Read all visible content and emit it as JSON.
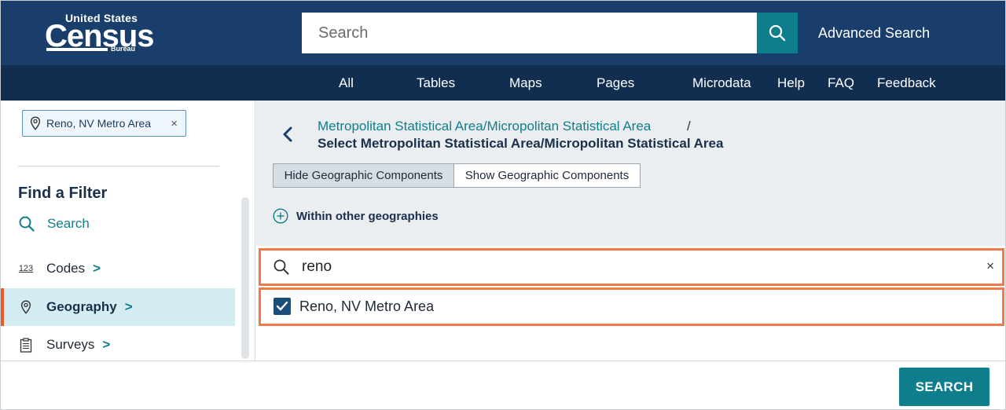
{
  "header": {
    "logo": {
      "line1": "United States",
      "line2": "Census",
      "line3": "Bureau"
    },
    "search": {
      "placeholder": "Search",
      "value": ""
    },
    "advanced_search": "Advanced Search"
  },
  "nav": {
    "items": [
      {
        "label": "All"
      },
      {
        "label": "Tables"
      },
      {
        "label": "Maps"
      },
      {
        "label": "Pages"
      },
      {
        "label": "Microdata"
      },
      {
        "label": "Help"
      },
      {
        "label": "FAQ"
      },
      {
        "label": "Feedback"
      }
    ]
  },
  "sidebar": {
    "chip": {
      "label": "Reno, NV Metro Area",
      "remove": "×",
      "icon": "location-pin-icon"
    },
    "find_filter_title": "Find a Filter",
    "search_label": "Search",
    "items": [
      {
        "label": "Codes",
        "icon": "codes-123-icon",
        "chevron": ">",
        "active": false
      },
      {
        "label": "Geography",
        "icon": "location-pin-icon",
        "chevron": ">",
        "active": true
      },
      {
        "label": "Surveys",
        "icon": "clipboard-icon",
        "chevron": ">",
        "active": false
      }
    ],
    "codes_icon_text": "123"
  },
  "main": {
    "breadcrumb": {
      "link": "Metropolitan Statistical Area/Micropolitan Statistical Area",
      "separator": "/",
      "current": "Select Metropolitan Statistical Area/Micropolitan Statistical Area"
    },
    "toggle": {
      "hide": "Hide Geographic Components",
      "show": "Show Geographic Components",
      "selected": "hide"
    },
    "within_label": "Within other geographies",
    "filter": {
      "value": "reno",
      "clear": "×"
    },
    "results": [
      {
        "label": "Reno, NV Metro Area",
        "checked": true
      }
    ]
  },
  "footer": {
    "search_button": "SEARCH"
  },
  "colors": {
    "header_bg": "#1a3e6b",
    "nav_bg": "#112e51",
    "accent_teal": "#0f7e8c",
    "highlight_orange": "#f07a4a",
    "active_item_bg": "#d3edf3"
  }
}
